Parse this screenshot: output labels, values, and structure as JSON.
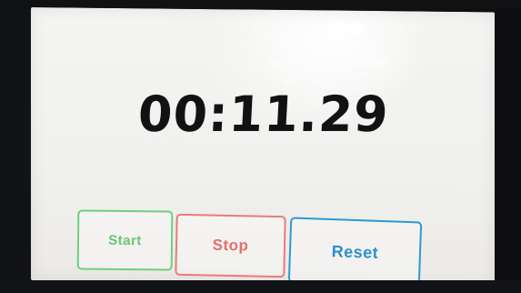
{
  "timer": {
    "display": "00:11.29"
  },
  "controls": {
    "start_label": "Start",
    "stop_label": "Stop",
    "reset_label": "Reset"
  },
  "colors": {
    "start": "#6fcf7c",
    "stop": "#ea7b78",
    "reset": "#2d9ad1",
    "timer_text": "#121212",
    "screen_background": "#f0f0ee"
  },
  "icons": []
}
